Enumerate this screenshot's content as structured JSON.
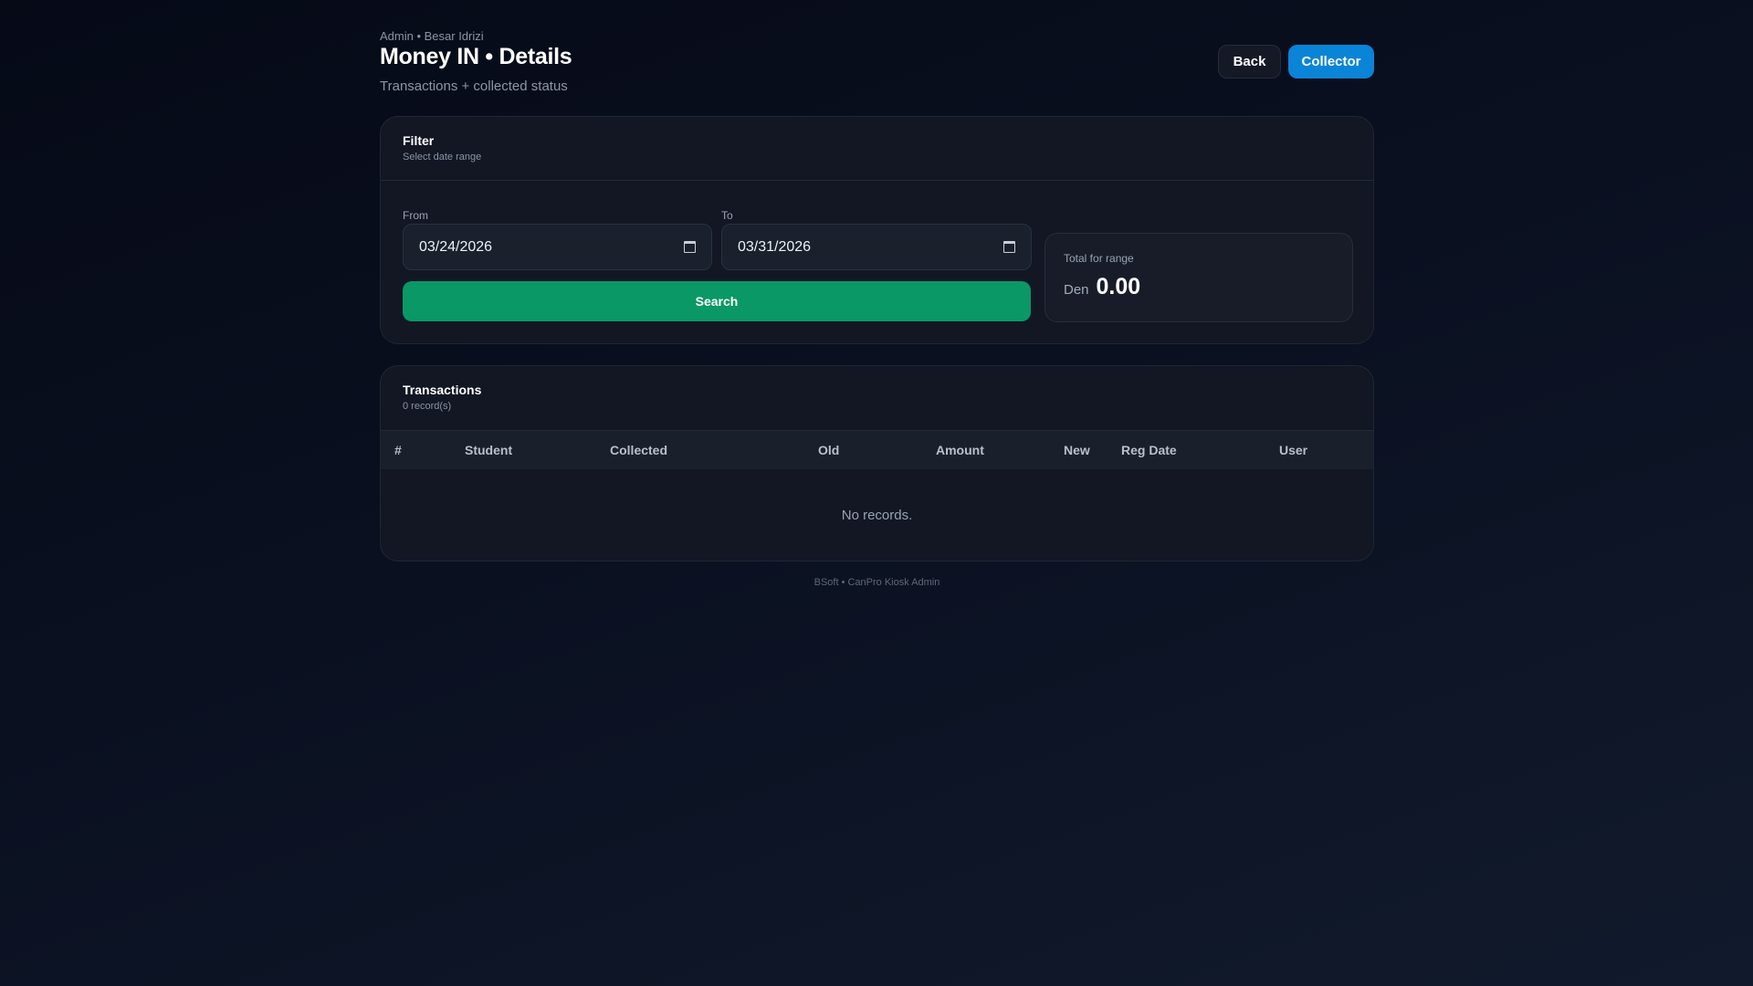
{
  "header": {
    "breadcrumb": "Admin • Besar Idrizi",
    "title": "Money IN • Details",
    "subtitle": "Transactions + collected status",
    "back_label": "Back",
    "collector_label": "Collector"
  },
  "filter": {
    "title": "Filter",
    "subtitle": "Select date range",
    "from_label": "From",
    "from_value": "03/24/2026",
    "to_label": "To",
    "to_value": "03/31/2026",
    "search_label": "Search",
    "total_label": "Total for range",
    "total_currency": "Den",
    "total_value": "0.00"
  },
  "transactions": {
    "title": "Transactions",
    "count": "0 record(s)",
    "columns": [
      "#",
      "Student",
      "Collected",
      "Old",
      "Amount",
      "New",
      "Reg Date",
      "User"
    ],
    "empty_text": "No records."
  },
  "footer": "BSoft • CanPro Kiosk Admin",
  "colors": {
    "accent": "#0a84d6",
    "search": "#0a9866",
    "background": "#0a1020"
  }
}
